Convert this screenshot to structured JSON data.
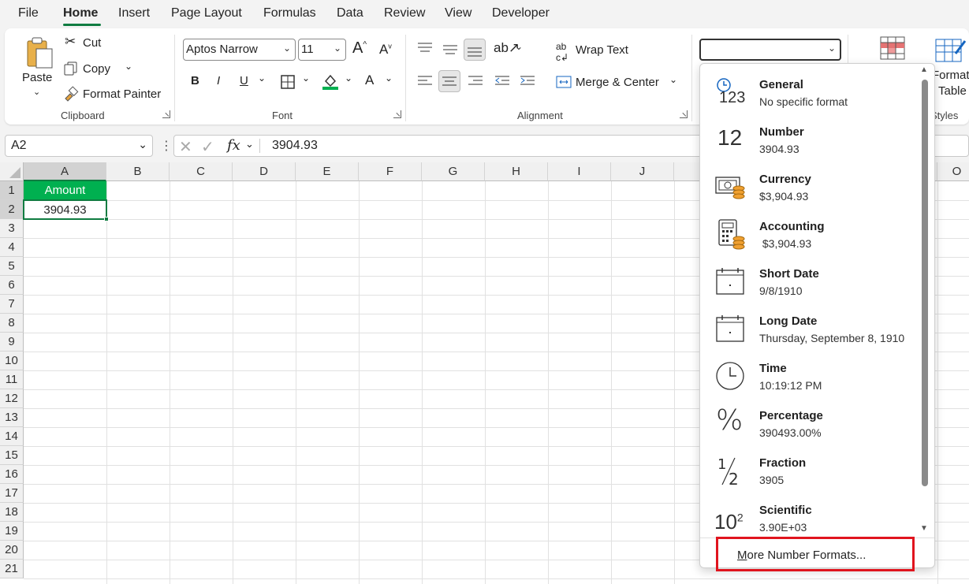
{
  "menu": {
    "tabs": [
      "File",
      "Home",
      "Insert",
      "Page Layout",
      "Formulas",
      "Data",
      "Review",
      "View",
      "Developer"
    ],
    "active": "Home"
  },
  "ribbon": {
    "clipboard": {
      "paste": "Paste",
      "cut": "Cut",
      "copy": "Copy",
      "format_painter": "Format Painter",
      "group": "Clipboard"
    },
    "font": {
      "name": "Aptos Narrow",
      "size": "11",
      "grow": "A",
      "shrink": "A",
      "bold": "B",
      "italic": "I",
      "underline": "U",
      "font_color": "A",
      "group": "Font"
    },
    "alignment": {
      "wrap_text": "Wrap Text",
      "merge_center": "Merge & Center",
      "group": "Alignment"
    },
    "number": {
      "format_value": ""
    },
    "styles": {
      "format_label_1": "Format",
      "format_label_2": "Table",
      "group": "Styles"
    }
  },
  "formula_bar": {
    "name_box": "A2",
    "fx": "fx",
    "formula": "3904.93"
  },
  "sheet": {
    "columns": [
      "A",
      "B",
      "C",
      "D",
      "E",
      "F",
      "G",
      "H",
      "I",
      "J",
      "O"
    ],
    "rows": [
      "1",
      "2",
      "3",
      "4",
      "5",
      "6",
      "7",
      "8",
      "9",
      "10",
      "11",
      "12",
      "13",
      "14",
      "15",
      "16",
      "17",
      "18",
      "19",
      "20",
      "21"
    ],
    "a1": "Amount",
    "a2": "3904.93",
    "header_fill": "#00b050"
  },
  "dropdown": {
    "items": [
      {
        "name": "General",
        "example": "No specific format",
        "icon": "general-icon",
        "icon_text": "123"
      },
      {
        "name": "Number",
        "example": "3904.93",
        "icon": "number-icon",
        "icon_text": "12"
      },
      {
        "name": "Currency",
        "example": "$3,904.93",
        "icon": "currency-icon"
      },
      {
        "name": "Accounting",
        "example": " $3,904.93",
        "icon": "accounting-icon"
      },
      {
        "name": "Short Date",
        "example": "9/8/1910",
        "icon": "short-date-icon"
      },
      {
        "name": "Long Date",
        "example": "Thursday, September 8, 1910",
        "icon": "long-date-icon"
      },
      {
        "name": "Time",
        "example": "10:19:12 PM",
        "icon": "time-icon"
      },
      {
        "name": "Percentage",
        "example": "390493.00%",
        "icon": "percentage-icon",
        "icon_text": "%"
      },
      {
        "name": "Fraction",
        "example": "3905",
        "icon": "fraction-icon"
      },
      {
        "name": "Scientific",
        "example": "3.90E+03",
        "icon": "scientific-icon",
        "icon_text": "10",
        "icon_sup": "2"
      }
    ],
    "more": "More Number Formats...",
    "highlight": "#e0141e"
  }
}
